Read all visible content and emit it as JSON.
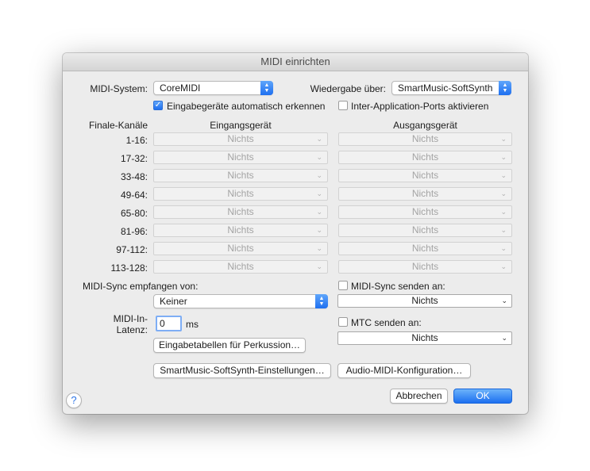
{
  "window": {
    "title": "MIDI einrichten"
  },
  "midi_system": {
    "label": "MIDI-System:",
    "value": "CoreMIDI"
  },
  "playback": {
    "label": "Wiedergabe über:",
    "value": "SmartMusic-SoftSynth"
  },
  "auto_detect": {
    "label": "Eingabegeräte automatisch erkennen",
    "checked": true
  },
  "inter_app": {
    "label": "Inter-Application-Ports aktivieren",
    "checked": false
  },
  "channels": {
    "header_channels": "Finale-Kanäle",
    "header_input": "Eingangsgerät",
    "header_output": "Ausgangsgerät",
    "rows": [
      {
        "range": "1-16:",
        "input": "Nichts",
        "output": "Nichts"
      },
      {
        "range": "17-32:",
        "input": "Nichts",
        "output": "Nichts"
      },
      {
        "range": "33-48:",
        "input": "Nichts",
        "output": "Nichts"
      },
      {
        "range": "49-64:",
        "input": "Nichts",
        "output": "Nichts"
      },
      {
        "range": "65-80:",
        "input": "Nichts",
        "output": "Nichts"
      },
      {
        "range": "81-96:",
        "input": "Nichts",
        "output": "Nichts"
      },
      {
        "range": "97-112:",
        "input": "Nichts",
        "output": "Nichts"
      },
      {
        "range": "113-128:",
        "input": "Nichts",
        "output": "Nichts"
      }
    ]
  },
  "sync_receive": {
    "label": "MIDI-Sync empfangen von:",
    "value": "Keiner"
  },
  "sync_send": {
    "label": "MIDI-Sync senden an:",
    "value": "Nichts",
    "checked": false
  },
  "latency": {
    "label_line1": "MIDI-In-",
    "label_line2": "Latenz:",
    "value": "0",
    "unit": "ms"
  },
  "mtc_send": {
    "label": "MTC senden an:",
    "value": "Nichts",
    "checked": false
  },
  "buttons": {
    "percussion": "Eingabetabellen für Perkussion…",
    "softsynth_settings": "SmartMusic-SoftSynth-Einstellungen…",
    "audio_midi": "Audio-MIDI-Konfiguration…",
    "cancel": "Abbrechen",
    "ok": "OK",
    "help": "?"
  },
  "icons": {
    "check": "✓",
    "chevron": "⌄",
    "updown_up": "▲",
    "updown_down": "▼"
  },
  "colors": {
    "accent": "#1e6ff0"
  }
}
